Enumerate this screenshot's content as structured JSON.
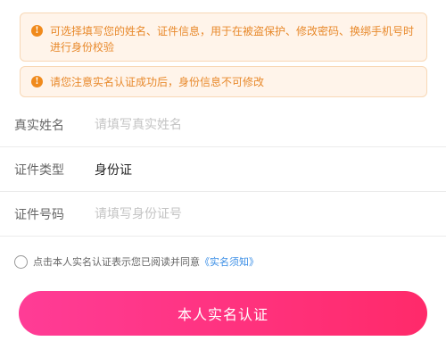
{
  "notices": [
    {
      "icon": "info-icon",
      "text": "可选择填写您的姓名、证件信息，用于在被盗保护、修改密码、换绑手机号时进行身份校验"
    },
    {
      "icon": "info-icon",
      "text": "请您注意实名认证成功后，身份信息不可修改"
    }
  ],
  "form": {
    "name": {
      "label": "真实姓名",
      "placeholder": "请填写真实姓名",
      "value": ""
    },
    "id_type": {
      "label": "证件类型",
      "value": "身份证"
    },
    "id_number": {
      "label": "证件号码",
      "placeholder": "请填写身份证号",
      "value": ""
    }
  },
  "agreement": {
    "text": "点击本人实名认证表示您已阅读并同意",
    "link": "《实名须知》",
    "checked": false
  },
  "submit_label": "本人实名认证",
  "colors": {
    "notice_bg": "#fff4ea",
    "notice_text": "#e8892b",
    "link": "#3a8ee6",
    "button_start": "#ff3c96",
    "button_end": "#ff2a6a"
  }
}
